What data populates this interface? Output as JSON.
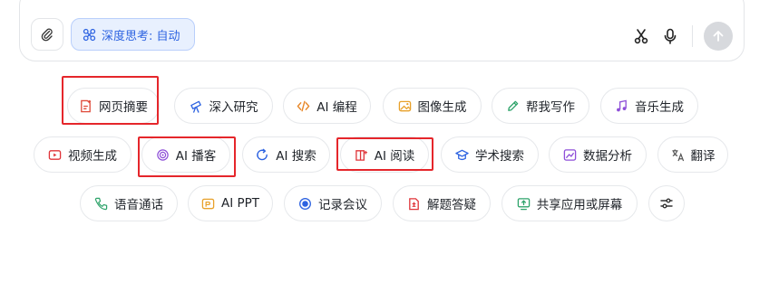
{
  "composer": {
    "deep_think_label": "深度思考: 自动"
  },
  "chips": {
    "row1": [
      "网页摘要",
      "深入研究",
      "AI 编程",
      "图像生成",
      "帮我写作",
      "音乐生成"
    ],
    "row2": [
      "视频生成",
      "AI 播客",
      "AI 搜索",
      "AI 阅读",
      "学术搜索",
      "数据分析",
      "翻译"
    ],
    "row3": [
      "语音通话",
      "AI PPT",
      "记录会议",
      "解题答疑",
      "共享应用或屏幕"
    ]
  },
  "colors": {
    "highlight": "#e5262b",
    "accent_blue": "#2d63e1",
    "send_disabled": "#d7d9dd"
  }
}
